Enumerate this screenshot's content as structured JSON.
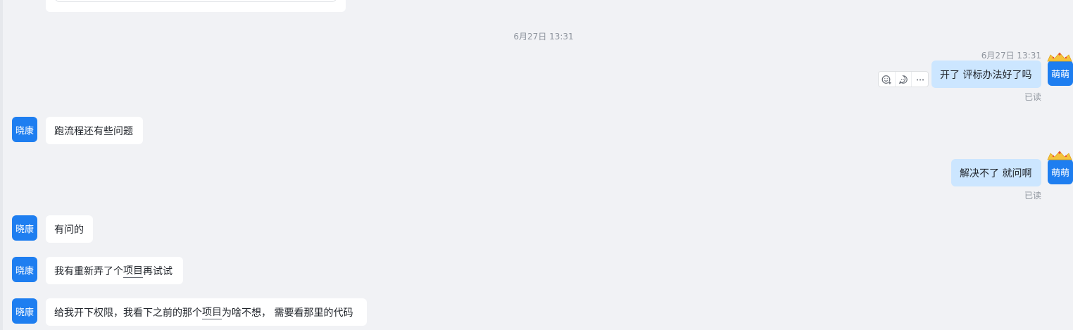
{
  "chat": {
    "date_divider": "6月27日 13:31",
    "toolbar_icons": [
      "add-reaction-icon",
      "reply-icon",
      "more-icon"
    ],
    "messages": [
      {
        "side": "right",
        "sender": "萌萌",
        "time": "6月27日 13:31",
        "text": "开了 评标办法好了吗",
        "status": "已读"
      },
      {
        "side": "left",
        "sender": "晓康",
        "text": "跑流程还有些问题"
      },
      {
        "side": "right",
        "sender": "萌萌",
        "text": "解决不了 就问啊",
        "status": "已读"
      },
      {
        "side": "left",
        "sender": "晓康",
        "text": "有问的"
      },
      {
        "side": "left",
        "sender": "晓康",
        "text_before": "我有重新弄了个",
        "text_link": "项目",
        "text_after": "再试试"
      },
      {
        "side": "left",
        "sender": "晓康",
        "text_before": "给我开下权限，我看下之前的那个",
        "text_link": "项目",
        "text_after": "为啥不想， 需要看那里的代码"
      }
    ]
  },
  "colors": {
    "background": "#f1f2f5",
    "avatar": "#1e7ef0",
    "outgoing_bubble": "#cce6ff",
    "incoming_bubble": "#ffffff",
    "meta_text": "#8f959e"
  }
}
